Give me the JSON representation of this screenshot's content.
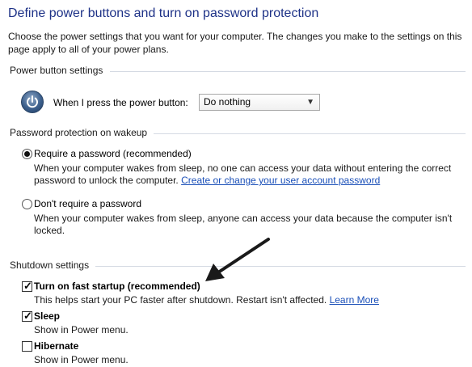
{
  "header": {
    "title": "Define power buttons and turn on password protection",
    "description": "Choose the power settings that you want for your computer. The changes you make to the settings on this page apply to all of your power plans."
  },
  "power_button": {
    "section_title": "Power button settings",
    "label": "When I press the power button:",
    "selected": "Do nothing",
    "icon": "power-icon"
  },
  "password": {
    "section_title": "Password protection on wakeup",
    "require_label": "Require a password (recommended)",
    "require_desc_line1": "When your computer wakes from sleep, no one can access your data without entering the correct",
    "require_desc_line2": "password to unlock the computer.",
    "require_link": "Create or change your user account password",
    "norequire_label": "Don't require a password",
    "norequire_desc_line1": "When your computer wakes from sleep, anyone can access your data because the computer isn't",
    "norequire_desc_line2": "locked.",
    "selected": "require"
  },
  "shutdown": {
    "section_title": "Shutdown settings",
    "fast_startup_label": "Turn on fast startup (recommended)",
    "fast_startup_desc": "This helps start your PC faster after shutdown. Restart isn't affected.",
    "fast_startup_link": "Learn More",
    "fast_startup_checked": true,
    "sleep_label": "Sleep",
    "sleep_desc": "Show in Power menu.",
    "sleep_checked": true,
    "hibernate_label": "Hibernate",
    "hibernate_desc": "Show in Power menu.",
    "hibernate_checked": false
  },
  "colors": {
    "title": "#1e3287",
    "link": "#1a4fb8",
    "divider": "#d5dae3"
  }
}
